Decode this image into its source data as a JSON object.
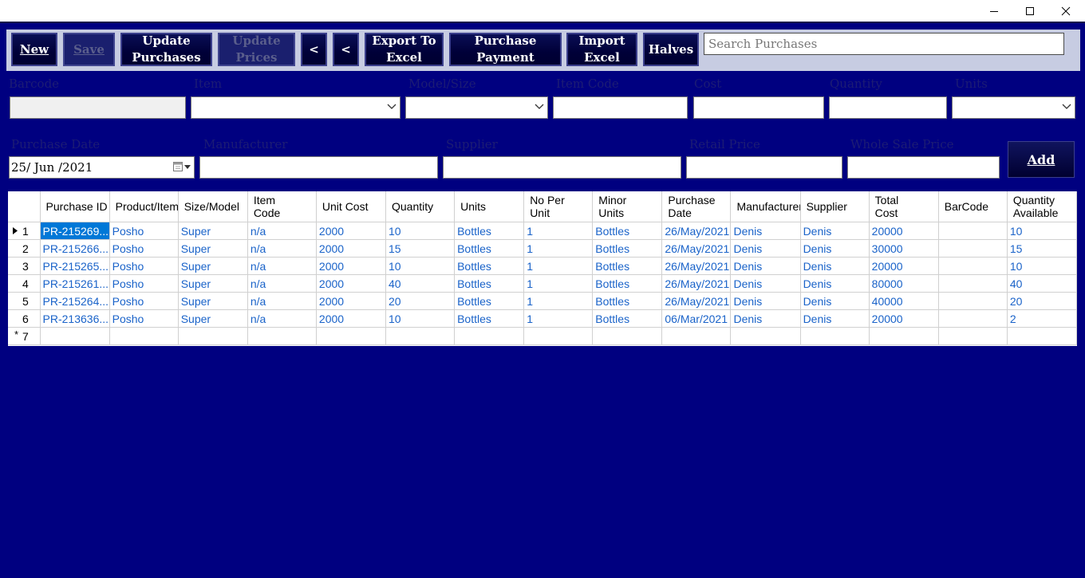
{
  "window": {
    "controls": {
      "minimize": "minimize-icon",
      "maximize": "maximize-icon",
      "close": "close-icon"
    }
  },
  "toolbar": {
    "new_label": "New",
    "save_label": "Save",
    "update_purchases_label": "Update\nPurchases",
    "update_prices_label": "Update\nPrices",
    "prev1_label": "<",
    "prev2_label": "<",
    "export_label": "Export To\nExcel",
    "purchase_payment_label": "Purchase Payment",
    "import_label": "Import\nExcel",
    "halves_label": "Halves",
    "search_placeholder": "Search Purchases"
  },
  "form": {
    "barcode_label": "Barcode",
    "item_label": "Item",
    "model_size_label": "Model/Size",
    "item_code_label": "Item Code",
    "cost_label": "Cost",
    "quantity_label": "Quantity",
    "units_label": "Units",
    "purchase_date_label": "Purchase Date",
    "purchase_date_value": "25/ Jun /2021",
    "manufacturer_label": "Manufacturer",
    "supplier_label": "Supplier",
    "retail_price_label": "Retail Price",
    "wholesale_price_label": "Whole Sale Price",
    "add_label": "Add"
  },
  "grid": {
    "columns": {
      "purchase_id": "Purchase ID",
      "product": "Product/Item",
      "size": "Size/Model",
      "item_code": "Item\nCode",
      "unit_cost": "Unit Cost",
      "quantity": "Quantity",
      "units": "Units",
      "no_per_unit": "No Per\nUnit",
      "minor_units": "Minor\nUnits",
      "purchase_date": "Purchase\nDate",
      "manufacturer": "Manufacturer",
      "supplier": "Supplier",
      "total_cost": "Total\nCost",
      "barcode": "BarCode",
      "qty_available": "Quantity\nAvailable"
    },
    "rows": [
      {
        "n": "1",
        "id": "PR-215269...",
        "product": "Posho",
        "size": "Super",
        "code": "n/a",
        "cost": "2000",
        "qty": "10",
        "units": "Bottles",
        "per": "1",
        "minor": "Bottles",
        "date": "26/May/2021",
        "mfr": "Denis",
        "sup": "Denis",
        "total": "20000",
        "barcode": "",
        "avail": "10"
      },
      {
        "n": "2",
        "id": "PR-215266...",
        "product": "Posho",
        "size": "Super",
        "code": "n/a",
        "cost": "2000",
        "qty": "15",
        "units": "Bottles",
        "per": "1",
        "minor": "Bottles",
        "date": "26/May/2021",
        "mfr": "Denis",
        "sup": "Denis",
        "total": "30000",
        "barcode": "",
        "avail": "15"
      },
      {
        "n": "3",
        "id": "PR-215265...",
        "product": "Posho",
        "size": "Super",
        "code": "n/a",
        "cost": "2000",
        "qty": "10",
        "units": "Bottles",
        "per": "1",
        "minor": "Bottles",
        "date": "26/May/2021",
        "mfr": "Denis",
        "sup": "Denis",
        "total": "20000",
        "barcode": "",
        "avail": "10"
      },
      {
        "n": "4",
        "id": "PR-215261...",
        "product": "Posho",
        "size": "Super",
        "code": "n/a",
        "cost": "2000",
        "qty": "40",
        "units": "Bottles",
        "per": "1",
        "minor": "Bottles",
        "date": "26/May/2021",
        "mfr": "Denis",
        "sup": "Denis",
        "total": "80000",
        "barcode": "",
        "avail": "40"
      },
      {
        "n": "5",
        "id": "PR-215264...",
        "product": "Posho",
        "size": "Super",
        "code": "n/a",
        "cost": "2000",
        "qty": "20",
        "units": "Bottles",
        "per": "1",
        "minor": "Bottles",
        "date": "26/May/2021",
        "mfr": "Denis",
        "sup": "Denis",
        "total": "40000",
        "barcode": "",
        "avail": "20"
      },
      {
        "n": "6",
        "id": "PR-213636...",
        "product": "Posho",
        "size": "Super",
        "code": "n/a",
        "cost": "2000",
        "qty": "10",
        "units": "Bottles",
        "per": "1",
        "minor": "Bottles",
        "date": "06/Mar/2021",
        "mfr": "Denis",
        "sup": "Denis",
        "total": "20000",
        "barcode": "",
        "avail": "2"
      }
    ],
    "new_row_number": "7"
  },
  "colors": {
    "app_bg": "#000080",
    "toolbar_bg": "#c7cce2",
    "cell_text": "#1a63c9",
    "selection": "#0078d7"
  }
}
